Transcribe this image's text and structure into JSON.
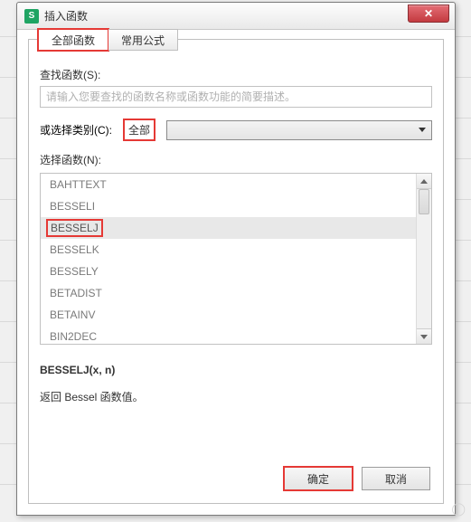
{
  "window": {
    "title": "插入函数"
  },
  "tabs": {
    "all": "全部函数",
    "formula": "常用公式"
  },
  "search": {
    "label": "查找函数(S):",
    "placeholder": "请输入您要查找的函数名称或函数功能的简要描述。"
  },
  "category": {
    "label": "或选择类别(C):",
    "value": "全部"
  },
  "funclist": {
    "label": "选择函数(N):",
    "items": [
      "BAHTTEXT",
      "BESSELI",
      "BESSELJ",
      "BESSELK",
      "BESSELY",
      "BETADIST",
      "BETAINV",
      "BIN2DEC"
    ],
    "selected_index": 2
  },
  "description": {
    "signature": "BESSELJ(x, n)",
    "text": "返回 Bessel 函数值。"
  },
  "buttons": {
    "ok": "确定",
    "cancel": "取消"
  }
}
